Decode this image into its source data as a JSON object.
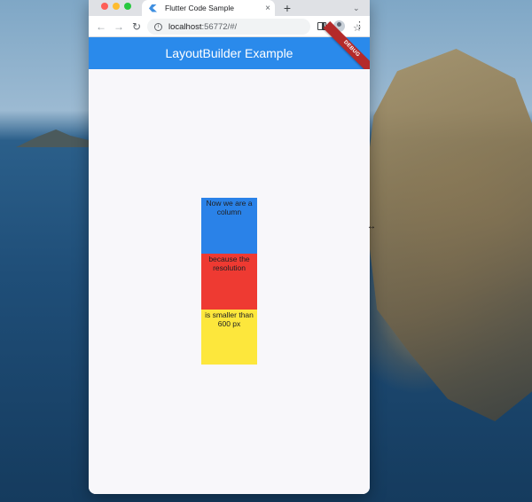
{
  "browser": {
    "tab_title": "Flutter Code Sample",
    "tab_close": "×",
    "new_tab": "+",
    "tab_menu": "⌄",
    "url_host": "localhost",
    "url_path": ":56772/#/",
    "icons": [
      "arrow-left-icon",
      "arrow-right-icon",
      "reload-icon",
      "info-icon",
      "share-icon",
      "star-icon",
      "side-panel-icon",
      "profile-icon",
      "more-vert-icon",
      "flutter-logo-icon"
    ]
  },
  "app": {
    "title": "LayoutBuilder Example",
    "debug_banner": "DEBUG",
    "boxes": [
      {
        "text": "Now we are a column",
        "color": "#2a82e8"
      },
      {
        "text": "because the resolution",
        "color": "#ee3a32"
      },
      {
        "text": "is smaller than 600 px",
        "color": "#fde73c"
      }
    ]
  },
  "colors": {
    "appbar": "#2a8aeb",
    "debug_banner": "#b42a2a",
    "background": "#f8f7fa"
  }
}
